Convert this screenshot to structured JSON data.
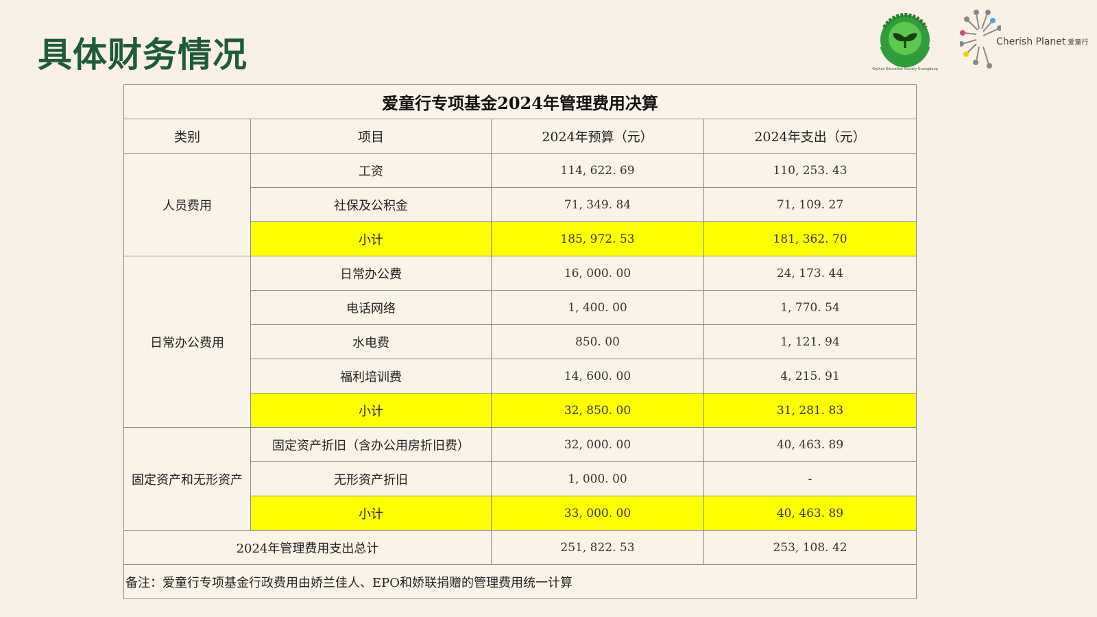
{
  "slide": {
    "title": "具体财务情况"
  },
  "logos": {
    "society_sub": "Orphan Education Society Guangdong",
    "cherish_brand": "Cherish Planet",
    "cherish_brand_cn": "爱童行"
  },
  "colors": {
    "title": "#1f5a3c",
    "subtotal": "#ffff00",
    "total": "#ffc000",
    "background": "#f9f1e6"
  },
  "table": {
    "caption": "爱童行专项基金2024年管理费用决算",
    "headers": [
      "类别",
      "项目",
      "2024年预算（元）",
      "2024年支出（元）"
    ],
    "groups": [
      {
        "category": "人员费用",
        "rows": [
          {
            "item": "工资",
            "budget": "114, 622. 69",
            "actual": "110, 253. 43"
          },
          {
            "item": "社保及公积金",
            "budget": "71, 349. 84",
            "actual": "71, 109. 27"
          }
        ],
        "subtotal": {
          "label": "小计",
          "budget": "185, 972. 53",
          "actual": "181, 362. 70"
        }
      },
      {
        "category": "日常办公费用",
        "rows": [
          {
            "item": "日常办公费",
            "budget": "16, 000. 00",
            "actual": "24, 173. 44"
          },
          {
            "item": "电话网络",
            "budget": "1, 400. 00",
            "actual": "1, 770. 54"
          },
          {
            "item": "水电费",
            "budget": "850. 00",
            "actual": "1, 121. 94"
          },
          {
            "item": "福利培训费",
            "budget": "14, 600. 00",
            "actual": "4, 215. 91"
          }
        ],
        "subtotal": {
          "label": "小计",
          "budget": "32, 850. 00",
          "actual": "31, 281. 83"
        }
      },
      {
        "category": "固定资产和无形资产",
        "rows": [
          {
            "item": "固定资产折旧（含办公用房折旧费）",
            "budget": "32, 000. 00",
            "actual": "40, 463. 89"
          },
          {
            "item": "无形资产折旧",
            "budget": "1, 000. 00",
            "actual": "-"
          }
        ],
        "subtotal": {
          "label": "小计",
          "budget": "33, 000. 00",
          "actual": "40, 463. 89"
        }
      }
    ],
    "total": {
      "label": "2024年管理费用支出总计",
      "budget": "251, 822. 53",
      "actual": "253, 108. 42"
    },
    "note": "备注：爱童行专项基金行政费用由娇兰佳人、EPO和娇联捐赠的管理费用统一计算"
  }
}
